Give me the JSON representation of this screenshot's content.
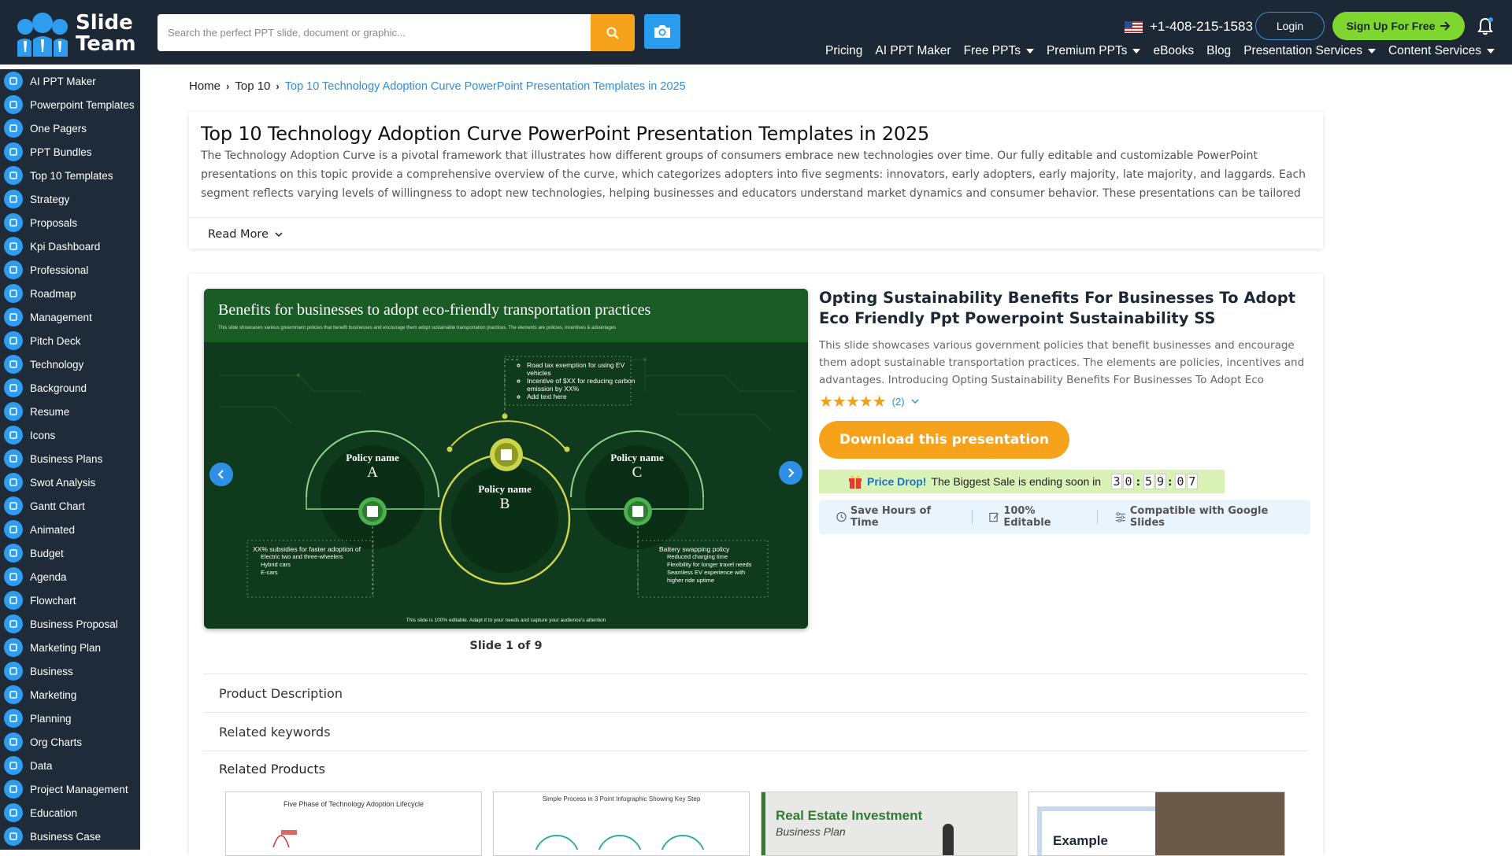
{
  "header": {
    "logo_line1": "Slide",
    "logo_line2": "Team",
    "search_placeholder": "Search the perfect PPT slide, document or graphic...",
    "phone": "+1-408-215-1583",
    "login_label": "Login",
    "signup_label": "Sign Up For Free",
    "nav": [
      {
        "label": "Pricing",
        "dropdown": false
      },
      {
        "label": "AI PPT Maker",
        "dropdown": false
      },
      {
        "label": "Free PPTs",
        "dropdown": true
      },
      {
        "label": "Premium PPTs",
        "dropdown": true
      },
      {
        "label": "eBooks",
        "dropdown": false
      },
      {
        "label": "Blog",
        "dropdown": false
      },
      {
        "label": "Presentation Services",
        "dropdown": true
      },
      {
        "label": "Content Services",
        "dropdown": true
      }
    ]
  },
  "sidebar": {
    "items": [
      {
        "label": "AI PPT Maker",
        "icon": "robot-icon"
      },
      {
        "label": "Powerpoint Templates",
        "icon": "presentation-icon"
      },
      {
        "label": "One Pagers",
        "icon": "page-icon"
      },
      {
        "label": "PPT Bundles",
        "icon": "bundle-icon"
      },
      {
        "label": "Top 10 Templates",
        "icon": "list-icon"
      },
      {
        "label": "Strategy",
        "icon": "strategy-icon"
      },
      {
        "label": "Proposals",
        "icon": "proposal-icon"
      },
      {
        "label": "Kpi Dashboard",
        "icon": "dashboard-icon"
      },
      {
        "label": "Professional",
        "icon": "briefcase-icon"
      },
      {
        "label": "Roadmap",
        "icon": "roadmap-icon"
      },
      {
        "label": "Management",
        "icon": "management-icon"
      },
      {
        "label": "Pitch Deck",
        "icon": "gauge-icon"
      },
      {
        "label": "Technology",
        "icon": "technology-icon"
      },
      {
        "label": "Background",
        "icon": "background-icon"
      },
      {
        "label": "Resume",
        "icon": "resume-icon"
      },
      {
        "label": "Icons",
        "icon": "globe-icon"
      },
      {
        "label": "Business Plans",
        "icon": "business-plan-icon"
      },
      {
        "label": "Swot Analysis",
        "icon": "gear-icon"
      },
      {
        "label": "Gantt Chart",
        "icon": "gantt-icon"
      },
      {
        "label": "Animated",
        "icon": "animated-icon"
      },
      {
        "label": "Budget",
        "icon": "budget-icon"
      },
      {
        "label": "Agenda",
        "icon": "agenda-icon"
      },
      {
        "label": "Flowchart",
        "icon": "flowchart-icon"
      },
      {
        "label": "Business Proposal",
        "icon": "table-icon"
      },
      {
        "label": "Marketing Plan",
        "icon": "search-icon"
      },
      {
        "label": "Business",
        "icon": "people-icon"
      },
      {
        "label": "Marketing",
        "icon": "funnel-icon"
      },
      {
        "label": "Planning",
        "icon": "puzzle-icon"
      },
      {
        "label": "Org Charts",
        "icon": "org-chart-icon"
      },
      {
        "label": "Data",
        "icon": "data-icon"
      },
      {
        "label": "Project Management",
        "icon": "project-icon"
      },
      {
        "label": "Education",
        "icon": "education-icon"
      },
      {
        "label": "Business Case",
        "icon": "roman-four-icon"
      }
    ]
  },
  "breadcrumb": {
    "home": "Home",
    "section": "Top 10",
    "current": "Top 10 Technology Adoption Curve PowerPoint Presentation Templates in 2025"
  },
  "intro": {
    "title": "Top 10 Technology Adoption Curve PowerPoint Presentation Templates in 2025",
    "description": "The Technology Adoption Curve is a pivotal framework that illustrates how different groups of consumers embrace new technologies over time. Our fully editable and customizable PowerPoint presentations on this topic provide a comprehensive overview of the curve, which categorizes adopters into five segments: innovators, early adopters, early majority, late majority, and laggards. Each segment reflects varying levels of willingness to adopt new technologies, helping businesses and educators understand market dynamics and consumer behavior. These presentations can be tailored to suit various use cases, such as corporate...",
    "read_more": "Read More"
  },
  "product": {
    "slide": {
      "title": "Benefits for businesses to adopt eco-friendly transportation practices",
      "subtitle": "This slide showcases various government policies that benefit businesses and encourage them adopt sustainable transportation practices. The elements are policies, incentives & advantages",
      "policy_label": "Policy name",
      "policy_a": "A",
      "policy_b": "B",
      "policy_c": "C",
      "top_bullets": [
        "Road tax exemption for using EV vehicles",
        "Incentive of $XX for reducing carbon emission by XX%",
        "Add text here"
      ],
      "left_bullet": "XX% subsidies for faster adoption of",
      "left_sub": [
        "Electric two and three-wheelers",
        "Hybrid cars",
        "E-cars"
      ],
      "right_bullet": "Battery swapping policy",
      "right_sub": [
        "Reduced charging time",
        "Flexibility for longer travel needs",
        "Seamless EV experience with higher ride uptime"
      ],
      "footer": "This slide is 100% editable. Adapt it to your needs and capture your audience's attention"
    },
    "slide_counter": "Slide 1 of 9",
    "title": "Opting Sustainability Benefits For Businesses To Adopt Eco Friendly Ppt Powerpoint Sustainability SS",
    "description": "This slide showcases various government policies that benefit businesses and encourage them adopt sustainable transportation practices. The elements are policies, incentives and advantages. Introducing Opting Sustainability Benefits For Businesses To Adopt Eco Friendly Ppt Powerpoint Sustainability SS t...",
    "stars": "★★★★★",
    "rating_value": 5,
    "rating_count": "(2)",
    "download_label": "Download this presentation",
    "price_drop_label": "Price Drop!",
    "price_drop_text": "The Biggest Sale is ending soon in",
    "countdown": [
      "3",
      "0",
      "5",
      "9",
      "0",
      "7"
    ],
    "features": [
      "Save Hours of Time",
      "100% Editable",
      "Compatible with Google Slides"
    ],
    "accordion": [
      "Product Description",
      "Related keywords"
    ],
    "related_title": "Related Products",
    "related": [
      {
        "caption": "Five Phase of Technology Adoption Lifecycle"
      },
      {
        "caption": "Simple Process in 3 Point Infographic Showing Key Step"
      },
      {
        "caption": "Real Estate Investment",
        "caption2": "Business Plan"
      },
      {
        "caption": "Example"
      }
    ]
  },
  "colors": {
    "header_bg": "#1c2836",
    "sidebar_bg": "#202b3a",
    "accent_orange": "#f7a21b",
    "accent_blue": "#2e9df0",
    "signup_green": "#7fd62f",
    "slide_green": "#0f3a1d"
  }
}
